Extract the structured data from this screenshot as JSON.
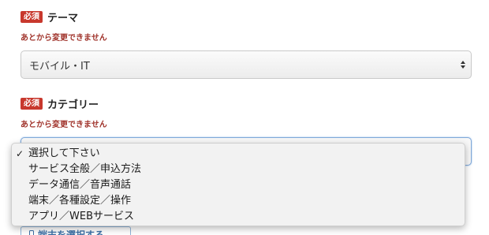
{
  "theme_field": {
    "badge": "必須",
    "label": "テーマ",
    "note": "あとから変更できません",
    "selected": "モバイル・IT"
  },
  "category_field": {
    "badge": "必須",
    "label": "カテゴリー",
    "note": "あとから変更できません",
    "options": [
      {
        "label": "選択して下さい",
        "checked": "✓"
      },
      {
        "label": "サービス全般／申込方法"
      },
      {
        "label": "データ通信／音声通話"
      },
      {
        "label": "端末／各種設定／操作"
      },
      {
        "label": "アプリ／WEBサービス"
      }
    ]
  },
  "device_button": {
    "label": "端末を選択する",
    "icon": "phone-icon"
  },
  "colors": {
    "badge": "#c8382d",
    "note": "#a0332b",
    "focus": "#7fa8d8"
  }
}
